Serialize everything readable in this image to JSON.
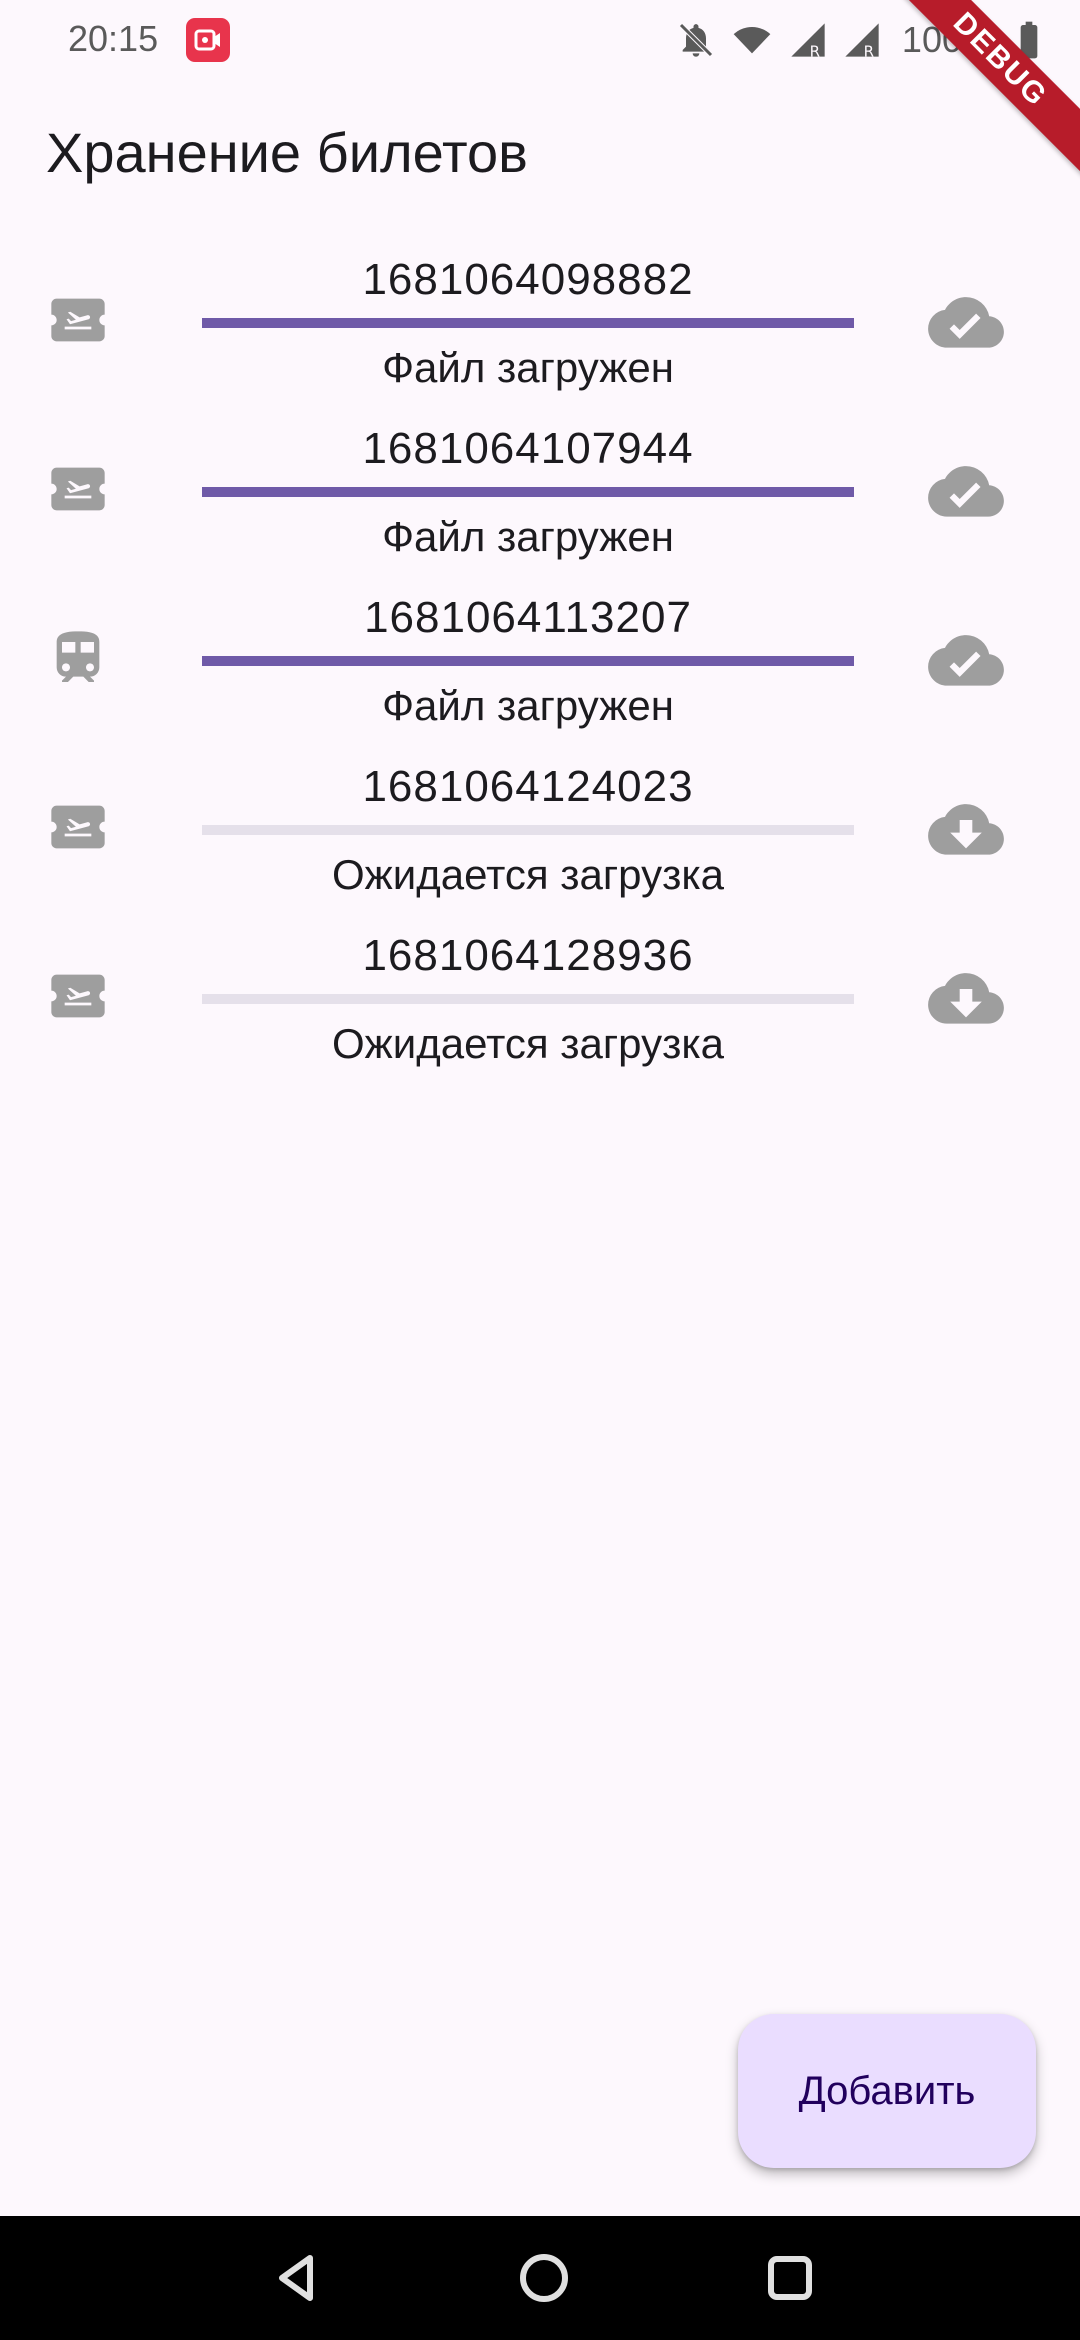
{
  "status_bar": {
    "time": "20:15",
    "battery": "100 %",
    "icons": [
      "screen-record-icon",
      "bell-off-icon",
      "wifi-icon",
      "signal-r-icon",
      "signal-r-icon",
      "battery-icon"
    ]
  },
  "debug_banner": "DEBUG",
  "page": {
    "title": "Хранение билетов"
  },
  "colors": {
    "accent": "#6f5aa8",
    "track": "#e5e0ea",
    "icon_gray": "#9e9e9e",
    "fab_bg": "#eaddff",
    "background": "#fdf8fd"
  },
  "tickets": [
    {
      "type_icon": "airplane-ticket-icon",
      "number": "1681064098882",
      "status": "Файл загружен",
      "progress": 1.0,
      "cloud_icon": "cloud-done-icon"
    },
    {
      "type_icon": "airplane-ticket-icon",
      "number": "1681064107944",
      "status": "Файл загружен",
      "progress": 1.0,
      "cloud_icon": "cloud-done-icon"
    },
    {
      "type_icon": "train-icon",
      "number": "1681064113207",
      "status": "Файл загружен",
      "progress": 1.0,
      "cloud_icon": "cloud-done-icon"
    },
    {
      "type_icon": "airplane-ticket-icon",
      "number": "1681064124023",
      "status": "Ожидается загрузка",
      "progress": 0.0,
      "cloud_icon": "cloud-download-icon"
    },
    {
      "type_icon": "airplane-ticket-icon",
      "number": "1681064128936",
      "status": "Ожидается загрузка",
      "progress": 0.0,
      "cloud_icon": "cloud-download-icon"
    }
  ],
  "fab": {
    "label": "Добавить"
  },
  "nav": {
    "icons": [
      "back-triangle-icon",
      "home-circle-icon",
      "recents-square-icon"
    ]
  }
}
